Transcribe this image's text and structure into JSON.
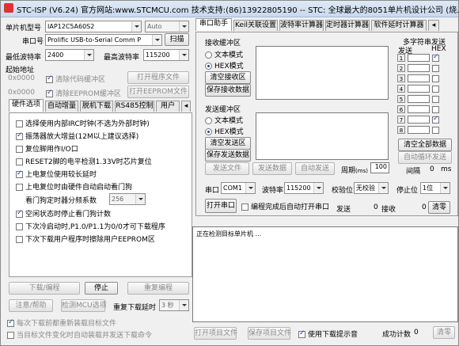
{
  "window": {
    "title": "STC-ISP (V6.24) 官方网站:www.STCMCU.com 技术支持:(86)13922805190 -- STC: 全球最大的8051单片机设计公司 (烧..."
  },
  "left": {
    "mcu_type_label": "单片机型号",
    "mcu_type_value": "IAP12C5A60S2",
    "auto_value": "Auto",
    "port_label": "串口号",
    "port_value": "Prolific USB-to-Serial Comm P",
    "scan_btn": "扫描",
    "min_baud_label": "最低波特率",
    "min_baud_value": "2400",
    "max_baud_label": "最高波特率",
    "max_baud_value": "115200",
    "start_addr_label": "起始地址",
    "addr1": "0x0000",
    "clear_code_label": "清除代码缓冲区",
    "open_prog_btn": "打开程序文件",
    "addr2": "0x0000",
    "clear_eeprom_label": "清除EEPROM缓冲区",
    "open_eeprom_btn": "打开EEPROM文件",
    "tabs": [
      "硬件选项",
      "自动增量",
      "脱机下载",
      "RS485控制",
      "用户"
    ],
    "options": [
      {
        "label": "选择使用内部IRC时钟(不选为外部时钟)",
        "checked": false
      },
      {
        "label": "振荡器放大增益(12M以上建议选择)",
        "checked": true
      },
      {
        "label": "复位脚用作I/O口",
        "checked": false
      },
      {
        "label": "RESET2脚的电平检测1.33V时芯片复位",
        "checked": false
      },
      {
        "label": "上电复位使用较长延时",
        "checked": true
      },
      {
        "label": "上电复位时由硬件自动启动看门狗",
        "checked": false
      }
    ],
    "wdt_label": "看门狗定时器分频系数",
    "wdt_value": "256",
    "options2": [
      {
        "label": "空闲状态时停止看门狗计数",
        "checked": true
      },
      {
        "label": "下次冷启动时,P1.0/P1.1为0/0才可下载程序",
        "checked": false
      },
      {
        "label": "下次下载用户程序时擦除用户EEPROM区",
        "checked": false
      }
    ],
    "download_btn": "下载/编程",
    "stop_btn": "停止",
    "reprog_btn": "重复编程",
    "help_btn": "注意/帮助",
    "detect_btn": "检测MCU选项",
    "repeat_delay_label": "重复下载延时",
    "repeat_delay_value": "3 秒",
    "reload_label": "每次下载前都重新装载目标文件",
    "autosend_label": "当目标文件变化时自动装载并发送下载命令"
  },
  "right": {
    "tabs": [
      "串口助手",
      "Keil关联设置",
      "波特率计算器",
      "定时器计算器",
      "软件延时计算器"
    ],
    "recv_title": "接收缓冲区",
    "text_mode": "文本模式",
    "hex_mode": "HEX模式",
    "clear_recv_btn": "清空接收区",
    "save_recv_btn": "保存接收数据",
    "multi_title": "多字符串发送",
    "multi_send_hdr": "发送",
    "multi_hex_hdr": "HEX",
    "multi_rows": [
      {
        "n": "1",
        "hex": true
      },
      {
        "n": "2",
        "hex": false
      },
      {
        "n": "3",
        "hex": false
      },
      {
        "n": "4",
        "hex": false
      },
      {
        "n": "5",
        "hex": false
      },
      {
        "n": "6",
        "hex": false
      },
      {
        "n": "7",
        "hex": true
      },
      {
        "n": "8",
        "hex": false
      }
    ],
    "send_title": "发送缓冲区",
    "clear_send_btn": "清空发送区",
    "save_send_btn": "保存发送数据",
    "clear_all_btn": "清空全部数据",
    "auto_loop_btn": "自动循环发送",
    "interval_label": "间隔",
    "interval_value": "0",
    "interval_unit": "ms",
    "send_file_btn": "发送文件",
    "send_data_btn": "发送数据",
    "auto_send_btn": "自动发送",
    "period_label": "周期",
    "period_unit": "(ms)",
    "period_value": "100",
    "port_label": "串口",
    "port_value": "COM1",
    "baud_label": "波特率",
    "baud_value": "115200",
    "parity_label": "校验位",
    "parity_value": "无校验",
    "stop_label": "停止位",
    "stop_value": "1位",
    "open_port_btn": "打开串口",
    "auto_open_label": "编程完成后自动打开串口",
    "send_label": "发送",
    "send_count": "0",
    "recv_label": "接收",
    "recv_count": "0",
    "clear_count_btn": "清零",
    "log_text": "正在检测目标单片机 ...",
    "open_project_btn": "打开项目文件",
    "save_project_btn": "保存项目文件",
    "beep_label": "使用下载提示音",
    "success_label": "成功计数",
    "success_value": "0",
    "clear_success_btn": "清零"
  }
}
